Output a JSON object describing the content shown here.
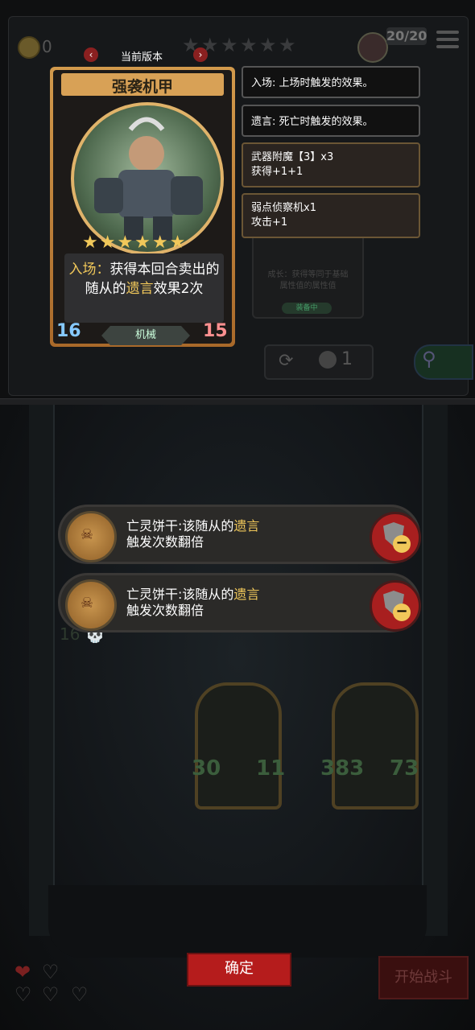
{
  "hud": {
    "coins": "0",
    "health": "20/20",
    "stars": [
      "★",
      "★",
      "★",
      "★",
      "★",
      "★"
    ]
  },
  "version": {
    "label": "当前版本",
    "prev": "‹",
    "next": "›"
  },
  "card": {
    "name": "强袭机甲",
    "stars": "★★★★★★",
    "desc_prefix": "入场：",
    "desc_mid": "获得本回合卖出的随从的",
    "desc_keyword": "遗言",
    "desc_suffix": "效果2次",
    "attack": "16",
    "health": "15",
    "tribe": "机械"
  },
  "tooltips": {
    "battlecry": "入场: 上场时触发的效果。",
    "deathrattle": "遗言: 死亡时触发的效果。",
    "enchant1_name": "武器附魔【3】x3",
    "enchant1_effect": "获得+1+1",
    "enchant2_name": "弱点侦察机x1",
    "enchant2_effect": "攻击+1"
  },
  "background_card": {
    "growth_text": "成长：获得等同于基础属性值的属性值",
    "button": "装备中"
  },
  "shop": {
    "refresh_cost": "1",
    "refresh_icon": "⟳",
    "search_icon": "⚲"
  },
  "buffs": [
    {
      "text_a": "亡灵饼干:该随从的",
      "keyword": "遗言",
      "text_b": "触发次数翻倍",
      "remove": "−"
    },
    {
      "text_a": "亡灵饼干:该随从的",
      "keyword": "遗言",
      "text_b": "触发次数翻倍",
      "remove": "−"
    }
  ],
  "board": {
    "ghost_stats": "16 💀",
    "minion1": {
      "attack": "30",
      "health": "11"
    },
    "minion2": {
      "attack": "383",
      "health": "73"
    }
  },
  "buttons": {
    "confirm": "确定",
    "start_battle": "开始战斗"
  },
  "lives": [
    "❤",
    "♡",
    "♡",
    "♡",
    "♡"
  ]
}
